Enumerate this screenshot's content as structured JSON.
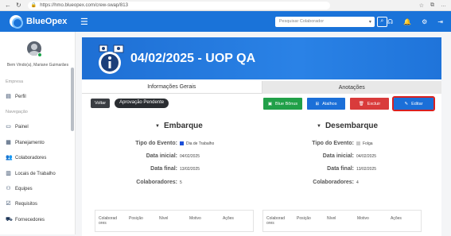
{
  "browser": {
    "url": "https://hmo.blueopex.com/crew-swap/813"
  },
  "app": {
    "name": "BlueOpex",
    "search_placeholder": "Pesquisar Colaborador",
    "brand_color": "#1a73d9"
  },
  "user": {
    "welcome": "Bem Vindo(a), Mariane Guimarães"
  },
  "sidebar": {
    "section_empresa": "Empresa",
    "section_navegacao": "Navegação",
    "items": [
      {
        "label": "Perfil",
        "icon": "id-card-icon"
      },
      {
        "label": "Painel",
        "icon": "desktop-icon"
      },
      {
        "label": "Planejamento",
        "icon": "calendar-icon"
      },
      {
        "label": "Colaboradores",
        "icon": "users-icon"
      },
      {
        "label": "Locais de Trabalho",
        "icon": "building-icon"
      },
      {
        "label": "Equipes",
        "icon": "team-icon"
      },
      {
        "label": "Requisitos",
        "icon": "checkbox-icon"
      },
      {
        "label": "Fornecedores",
        "icon": "truck-icon"
      }
    ]
  },
  "banner": {
    "title": "04/02/2025 - UOP QA"
  },
  "tabs": [
    {
      "label": "Informações Gerais",
      "active": true
    },
    {
      "label": "Anotações",
      "active": false
    }
  ],
  "status": {
    "back_label": "Voltar",
    "badge": "Aprovação Pendente"
  },
  "actions": {
    "blue_bonus": "Blue Bônus",
    "atalhos": "Atalhos",
    "excluir": "Excluir",
    "editar": "Editar"
  },
  "embarque": {
    "title": "Embarque",
    "tipo_evento_label": "Tipo do Evento:",
    "tipo_evento_value": "Dia de Trabalho",
    "tipo_evento_color": "#1b4fd8",
    "data_inicial_label": "Data inicial:",
    "data_inicial_value": "04/02/2025",
    "data_final_label": "Data final:",
    "data_final_value": "13/02/2025",
    "colaboradores_label": "Colaboradores:",
    "colaboradores_value": "5"
  },
  "desembarque": {
    "title": "Desembarque",
    "tipo_evento_label": "Tipo do Evento:",
    "tipo_evento_value": "Folga",
    "tipo_evento_color": "#c8c8c8",
    "data_inicial_label": "Data inicial:",
    "data_inicial_value": "04/02/2025",
    "data_final_label": "Data final:",
    "data_final_value": "13/02/2025",
    "colaboradores_label": "Colaboradores:",
    "colaboradores_value": "4"
  },
  "table": {
    "headers": [
      "Colaborad ores",
      "Posição",
      "Nível",
      "Motivo",
      "Ações"
    ]
  }
}
